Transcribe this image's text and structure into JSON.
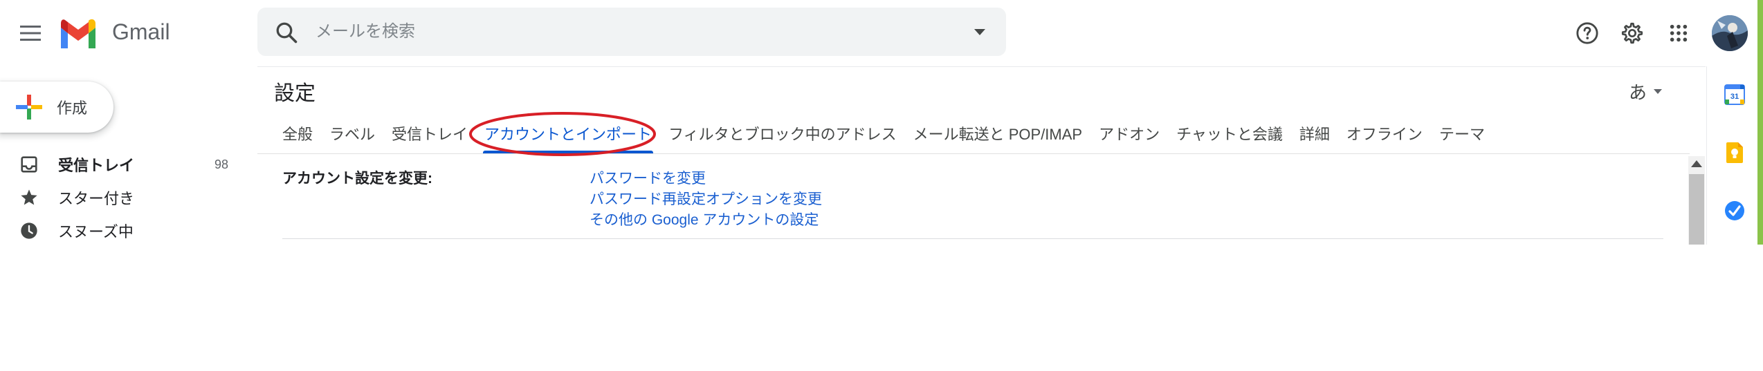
{
  "header": {
    "app_name": "Gmail",
    "search_placeholder": "メールを検索",
    "icons": [
      "main-menu-icon",
      "search-icon",
      "search-options-icon",
      "help-icon",
      "settings-icon",
      "apps-icon",
      "avatar"
    ]
  },
  "sidebar": {
    "compose_label": "作成",
    "items": [
      {
        "label": "受信トレイ",
        "count": "98",
        "icon": "inbox-icon",
        "bold": true
      },
      {
        "label": "スター付き",
        "count": "",
        "icon": "star-icon",
        "bold": false
      },
      {
        "label": "スヌーズ中",
        "count": "",
        "icon": "clock-icon",
        "bold": false
      }
    ]
  },
  "settings": {
    "title": "設定",
    "input_tool": "あ",
    "tabs": [
      {
        "label": "全般",
        "active": false
      },
      {
        "label": "ラベル",
        "active": false
      },
      {
        "label": "受信トレイ",
        "active": false
      },
      {
        "label": "アカウントとインポート",
        "active": true
      },
      {
        "label": "フィルタとブロック中のアドレス",
        "active": false
      },
      {
        "label": "メール転送と POP/IMAP",
        "active": false
      },
      {
        "label": "アドオン",
        "active": false
      },
      {
        "label": "チャットと会議",
        "active": false
      },
      {
        "label": "詳細",
        "active": false
      },
      {
        "label": "オフライン",
        "active": false
      },
      {
        "label": "テーマ",
        "active": false
      }
    ],
    "account_section": {
      "label": "アカウント設定を変更:",
      "links": [
        "パスワードを変更",
        "パスワード再設定オプションを変更",
        "その他の Google アカウントの設定"
      ]
    }
  },
  "side_panel": {
    "apps": [
      "calendar-icon",
      "keep-icon",
      "tasks-icon"
    ],
    "calendar_day": "31"
  },
  "colors": {
    "accent": "#0b57d0",
    "link": "#1a5fd0",
    "annotation_circle": "#d81f26",
    "edge_bar": "#8bc34a"
  }
}
